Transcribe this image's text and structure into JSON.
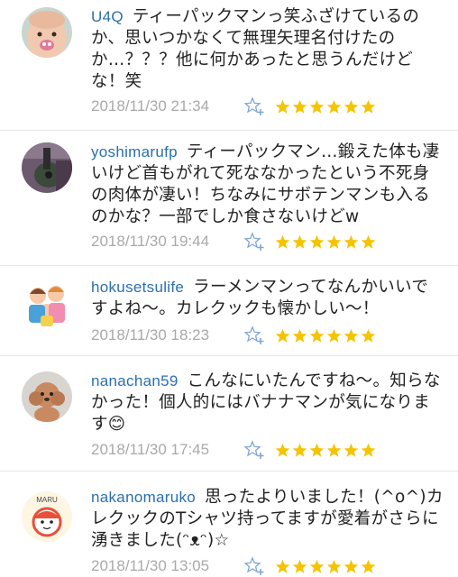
{
  "colors": {
    "username": "#2a6fb0",
    "timestamp": "#a9a9a9",
    "star": "#f5c400",
    "fav_icon": "#7fa7d6",
    "divider": "#e6e6e6"
  },
  "comments": [
    {
      "username": "U4Q",
      "text": "ティーパックマンっ笑ふざけているのか、思いつかなくて無理矢理名付けたのか…？？？他に何かあったと思うんだけどな！笑",
      "timestamp": "2018/11/30 21:34",
      "rating": 6,
      "avatar_icon": "baby-face-avatar"
    },
    {
      "username": "yoshimarufp",
      "text": "ティーパックマン…鍛えた体も凄いけど首もがれて死ななかったという不死身の肉体が凄い！ちなみにサボテンマンも入るのかな？一部でしか食さないけどw",
      "timestamp": "2018/11/30 19:44",
      "rating": 6,
      "avatar_icon": "guitar-avatar"
    },
    {
      "username": "hokusetsulife",
      "text": "ラーメンマンってなんかいいですよね〜。カレクックも懐かしい〜！",
      "timestamp": "2018/11/30 18:23",
      "rating": 6,
      "avatar_icon": "family-illustration-avatar"
    },
    {
      "username": "nanachan59",
      "text": "こんなにいたんですね〜。知らなかった！個人的にはバナナマンが気になります😊",
      "timestamp": "2018/11/30 17:45",
      "rating": 6,
      "avatar_icon": "poodle-dog-avatar"
    },
    {
      "username": "nakanomaruko",
      "text": "思ったよりいました！(^o^)カレクックのTシャツ持ってますが愛着がさらに湧きました(ᵔᴥᵔ)☆",
      "timestamp": "2018/11/30 13:05",
      "rating": 6,
      "avatar_icon": "maru-character-avatar",
      "avatar_label": "MARU"
    }
  ]
}
